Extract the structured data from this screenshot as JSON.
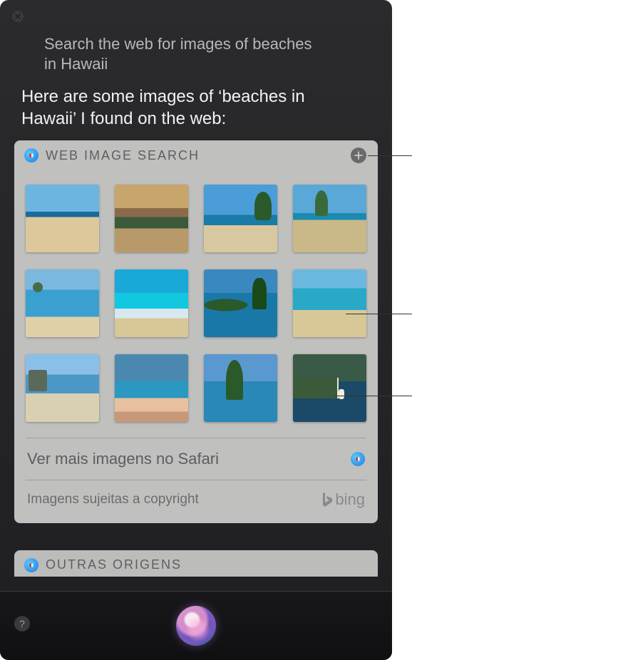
{
  "query": "Search the web for images of beaches in Hawaii",
  "response": "Here are some images of ‘beaches in Hawaii’ I found on the web:",
  "card": {
    "title": "WEB IMAGE SEARCH",
    "more_label": "Ver mais imagens no Safari",
    "copyright_label": "Imagens sujeitas a copyright",
    "provider_label": "bing"
  },
  "other_card": {
    "title": "OUTRAS ORIGENS"
  },
  "help_label": "?"
}
